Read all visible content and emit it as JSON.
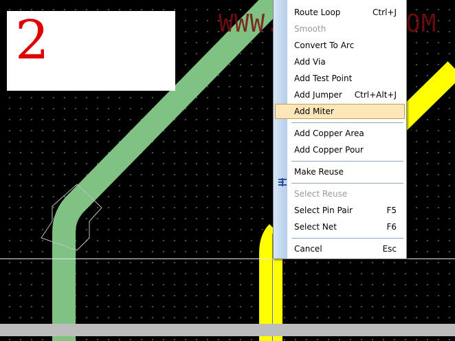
{
  "overlay": {
    "step_number": "2",
    "watermark": "WWW.EDA365.COM"
  },
  "canvas": {
    "background_color": "#000000",
    "grid_dot_color": "#6a6a6a",
    "trace_color_green": "#7fc283",
    "trace_color_yellow": "#ffff00"
  },
  "context_menu": {
    "items": [
      {
        "label": "Route Loop",
        "shortcut": "Ctrl+J",
        "disabled": false
      },
      {
        "label": "Smooth",
        "shortcut": "",
        "disabled": true
      },
      {
        "label": "Convert To Arc",
        "shortcut": "",
        "disabled": false
      },
      {
        "label": "Add Via",
        "shortcut": "",
        "disabled": false
      },
      {
        "label": "Add Test Point",
        "shortcut": "",
        "disabled": false
      },
      {
        "label": "Add Jumper",
        "shortcut": "Ctrl+Alt+J",
        "disabled": false,
        "icon": "jumper-icon"
      },
      {
        "label": "Add Miter",
        "shortcut": "",
        "disabled": false,
        "highlighted": true
      },
      {
        "label": "Add Copper Area",
        "shortcut": "",
        "disabled": false
      },
      {
        "label": "Add Copper Pour",
        "shortcut": "",
        "disabled": false
      },
      {
        "label": "Make Reuse",
        "shortcut": "",
        "disabled": false
      },
      {
        "label": "Select Reuse",
        "shortcut": "",
        "disabled": true
      },
      {
        "label": "Select Pin Pair",
        "shortcut": "F5",
        "disabled": false
      },
      {
        "label": "Select Net",
        "shortcut": "F6",
        "disabled": false
      },
      {
        "label": "Cancel",
        "shortcut": "Esc",
        "disabled": false
      }
    ]
  }
}
